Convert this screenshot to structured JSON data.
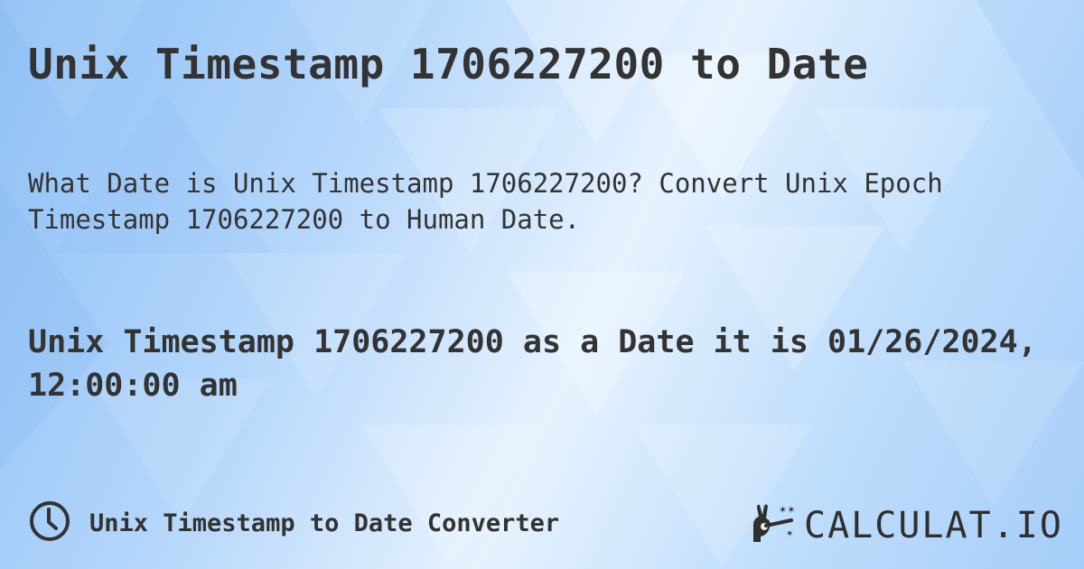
{
  "title": "Unix Timestamp 1706227200 to Date",
  "subtitle": "What Date is Unix Timestamp 1706227200? Convert Unix Epoch Timestamp 1706227200 to Human Date.",
  "answer": "Unix Timestamp 1706227200 as a Date it is 01/26/2024, 12:00:00 am",
  "footer": {
    "icon": "clock-icon",
    "label": "Unix Timestamp to Date Converter"
  },
  "brand": {
    "icon": "magic-hand-icon",
    "name": "CALCULAT.IO"
  }
}
